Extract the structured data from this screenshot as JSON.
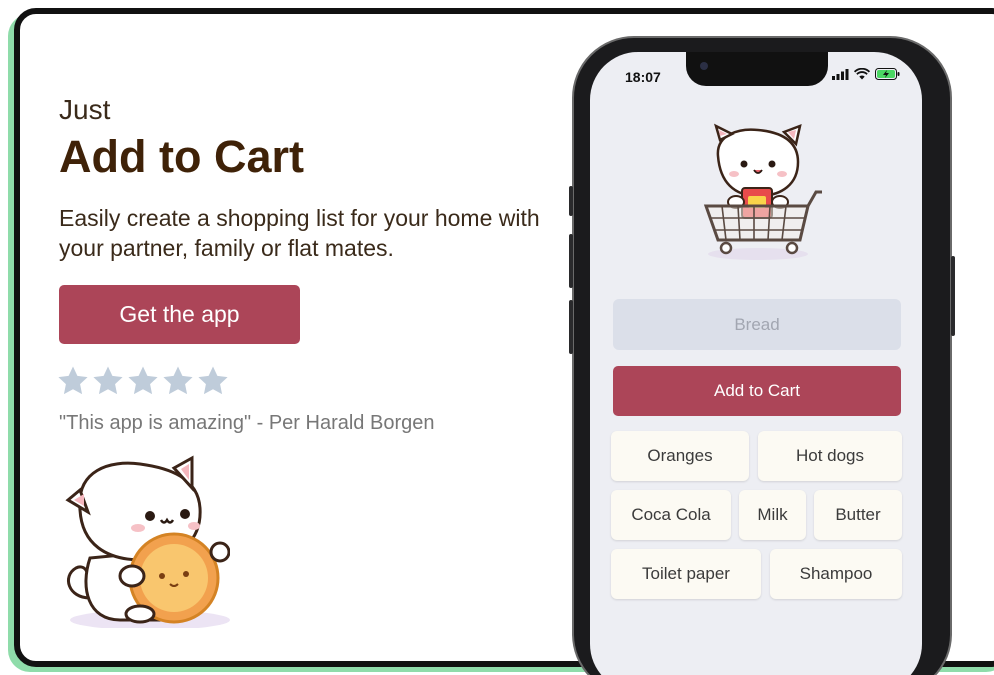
{
  "hero": {
    "eyebrow": "Just",
    "headline": "Add to Cart",
    "subtitle": "Easily create a shopping list for your home with your partner, family or flat mates.",
    "cta_label": "Get the app",
    "rating": {
      "stars": 5
    },
    "quote": "\"This app is amazing\" - Per Harald Borgen"
  },
  "phone": {
    "status_time": "18:07",
    "input": {
      "placeholder": "Bread",
      "value": ""
    },
    "add_button_label": "Add to Cart",
    "items": [
      "Oranges",
      "Hot dogs",
      "Coca Cola",
      "Milk",
      "Butter",
      "Toilet paper",
      "Shampoo"
    ]
  },
  "colors": {
    "accent": "#ac4558",
    "headline": "#3f2208",
    "star": "#bfccda",
    "chip_bg": "#fcfaf3",
    "input_bg": "#dbdfe9",
    "frame_shadow": "#8fdcaa"
  },
  "icons": [
    "star-icon",
    "cellular-signal-icon",
    "wifi-icon",
    "battery-charging-icon",
    "cat-mooncake-illustration",
    "cat-shopping-cart-illustration"
  ]
}
